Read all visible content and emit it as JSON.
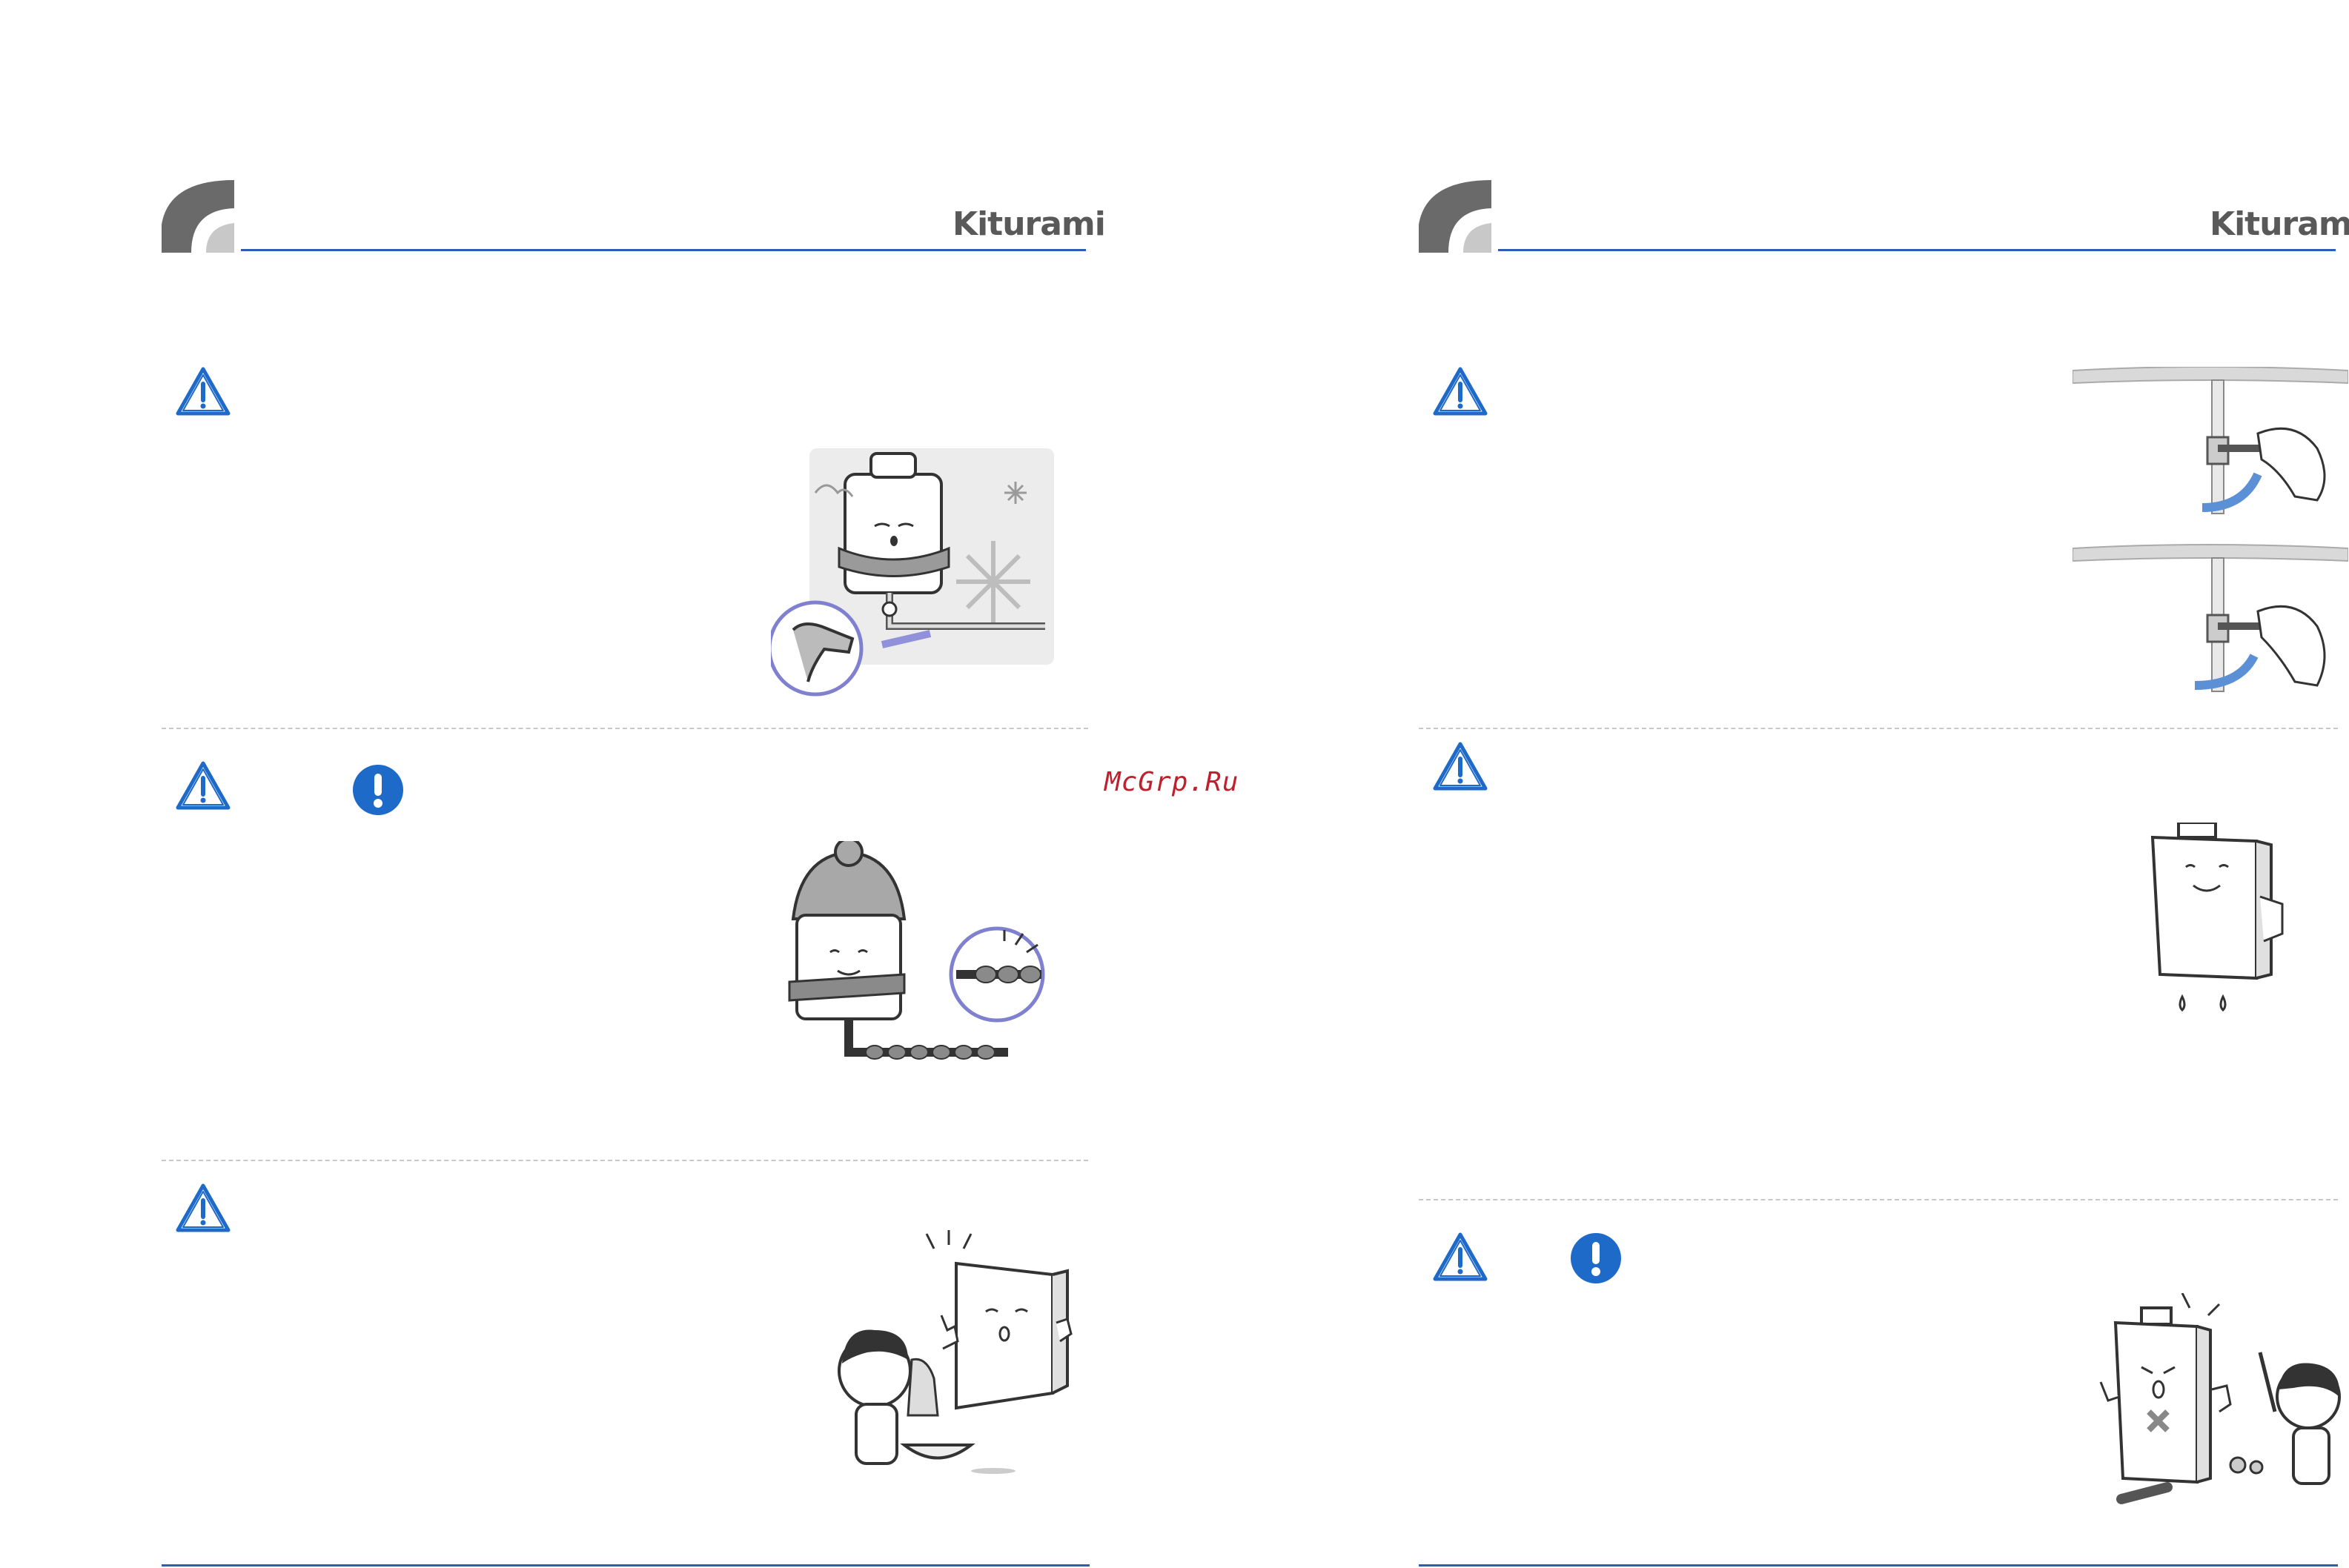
{
  "brand": "Kiturami",
  "watermark": "McGrp.Ru",
  "colors": {
    "accent_blue": "#2d5db4",
    "mandatory_blue": "#1e6ac8",
    "watermark_red": "#c0202e",
    "corner_dark": "#6a6a6a",
    "corner_light": "#c8c8c8"
  },
  "left_page": {
    "sections": [
      {
        "icons": [
          "warning-icon"
        ],
        "illustration": "frozen-boiler-hairdryer"
      },
      {
        "icons": [
          "warning-icon",
          "mandatory-icon"
        ],
        "illustration": "boiler-winter-hat-pipe"
      },
      {
        "icons": [
          "warning-icon"
        ],
        "illustration": "child-washing-near-boiler"
      }
    ]
  },
  "right_page": {
    "sections": [
      {
        "icons": [
          "warning-icon"
        ],
        "illustration": "hand-turning-valves"
      },
      {
        "icons": [
          "warning-icon"
        ],
        "illustration": "boiler-leaking-water"
      },
      {
        "icons": [
          "warning-icon",
          "mandatory-icon"
        ],
        "illustration": "child-with-screwdriver-disassembly"
      }
    ]
  }
}
